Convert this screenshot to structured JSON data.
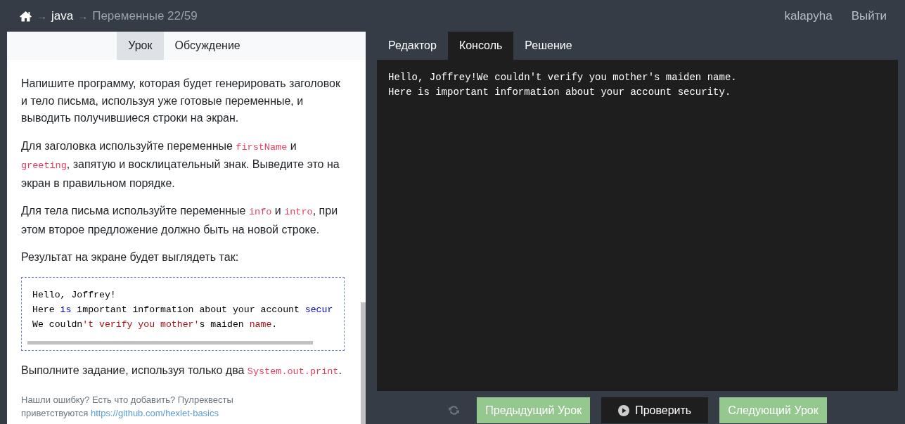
{
  "breadcrumb": [
    {
      "kind": "home"
    },
    {
      "kind": "link",
      "separator": "→",
      "label": "java"
    },
    {
      "kind": "current",
      "separator": "→",
      "label": "Переменные 22/59"
    }
  ],
  "user_menu": [
    "kalapyha",
    "Выйти"
  ],
  "lesson_tabs": [
    {
      "label": "Урок",
      "selected": true
    },
    {
      "label": "Обсуждение",
      "selected": false
    }
  ],
  "lesson": [
    {
      "kind": "paragraph",
      "parts": [
        {
          "kind": "text",
          "text": "Напишите программу, которая будет генерировать заголовок и тело письма, используя уже готовые переменные, и выводить получившиеся строки на экран."
        }
      ]
    },
    {
      "kind": "paragraph",
      "parts": [
        {
          "kind": "text",
          "text": "Для заголовка используйте переменные "
        },
        {
          "kind": "code",
          "text": "firstName"
        },
        {
          "kind": "text",
          "text": " и "
        },
        {
          "kind": "code",
          "text": "greeting"
        },
        {
          "kind": "text",
          "text": ", запятую и восклицательный знак. Выведите это на экран в правильном порядке."
        }
      ]
    },
    {
      "kind": "paragraph",
      "parts": [
        {
          "kind": "text",
          "text": "Для тела письма используйте переменные "
        },
        {
          "kind": "code",
          "text": "info"
        },
        {
          "kind": "text",
          "text": " и "
        },
        {
          "kind": "code",
          "text": "intro"
        },
        {
          "kind": "text",
          "text": ", при этом второе предложение должно быть на новой строке."
        }
      ]
    },
    {
      "kind": "paragraph",
      "parts": [
        {
          "kind": "text",
          "text": "Результат на экране будет выглядеть так:"
        }
      ]
    },
    {
      "kind": "codeblock",
      "lines": [
        [
          {
            "kind": "plain",
            "text": "Hello, Joffrey!"
          }
        ],
        [
          {
            "kind": "plain",
            "text": "Here "
          },
          {
            "kind": "keyword",
            "text": "is"
          },
          {
            "kind": "plain",
            "text": " important information about your account "
          },
          {
            "kind": "keyword",
            "text": "secur"
          }
        ],
        [
          {
            "kind": "plain",
            "text": "We couldn"
          },
          {
            "kind": "string",
            "text": "'t verify you mother'"
          },
          {
            "kind": "plain",
            "text": "s maiden "
          },
          {
            "kind": "string",
            "text": "name"
          },
          {
            "kind": "plain",
            "text": "."
          }
        ]
      ]
    },
    {
      "kind": "paragraph",
      "parts": [
        {
          "kind": "text",
          "text": "Выполните задание, используя только два "
        },
        {
          "kind": "code",
          "text": "System.out.print"
        },
        {
          "kind": "text",
          "text": "."
        }
      ]
    },
    {
      "kind": "footnote",
      "parts": [
        {
          "kind": "text",
          "text": "Нашли ошибку? Есть что добавить? Пулреквесты приветствуются "
        },
        {
          "kind": "link",
          "text": "https://github.com/hexlet-basics"
        }
      ]
    }
  ],
  "editor_tabs": [
    {
      "label": "Редактор",
      "selected": false
    },
    {
      "label": "Консоль",
      "selected": true
    },
    {
      "label": "Решение",
      "selected": false
    }
  ],
  "console_lines": [
    "Hello, Joffrey!We couldn't verify you mother's maiden name.",
    "Here is important information about your account security."
  ],
  "buttons": [
    {
      "kind": "reset"
    },
    {
      "kind": "nav",
      "label": "Предыдущий Урок"
    },
    {
      "kind": "run",
      "label": "Проверить"
    },
    {
      "kind": "nav",
      "label": "Следующий Урок"
    }
  ]
}
